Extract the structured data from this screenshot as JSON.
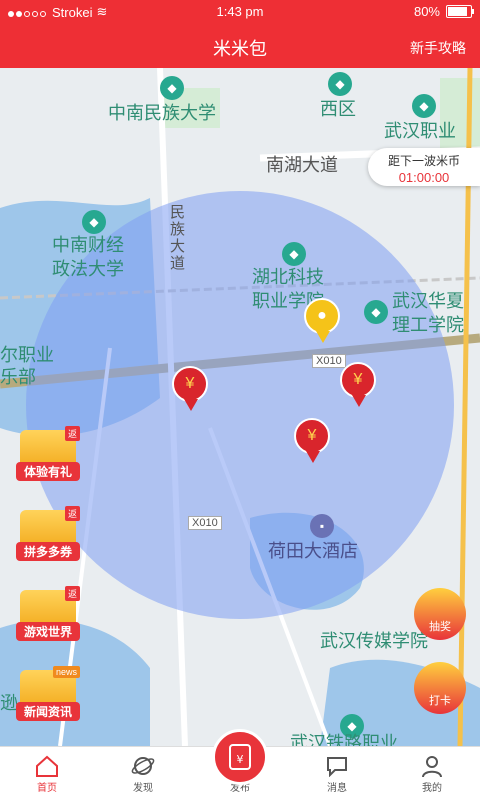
{
  "status": {
    "carrier": "Strokei",
    "time": "1:43 pm",
    "battery": "80%"
  },
  "nav": {
    "title": "米米包",
    "guide": "新手攻略"
  },
  "map": {
    "labels": {
      "zhongnan_minzu": "中南民族大学",
      "xiqu": "西区",
      "wuhan_zhiye": "武汉职业",
      "nanhu_road": "南湖大道",
      "zhongnan_caijing_1": "中南财经",
      "zhongnan_caijing_2": "政法大学",
      "minzu_road": "民族大道",
      "hubei_keji_1": "湖北科技",
      "hubei_keji_2": "职业学院",
      "wuhan_huaxia_1": "武汉华夏",
      "wuhan_huaxia_2": "理工学院",
      "left_cut_1": "尔职业",
      "left_cut_2": "乐部",
      "hetian": "荷田大酒店",
      "wuhan_chuanmei": "武汉传媒学院",
      "wuhan_tielu": "武汉铁路职业",
      "left_bottom": "逊"
    },
    "road_tag_1": "X010",
    "road_tag_2": "X010"
  },
  "countdown": {
    "label": "距下一波米币",
    "time": "01:00:00"
  },
  "side_menu": [
    {
      "label": "体验有礼",
      "tag": "返"
    },
    {
      "label": "拼多多券",
      "tag": "返"
    },
    {
      "label": "游戏世界",
      "tag": "返"
    },
    {
      "label": "新闻资讯",
      "tag": "news"
    }
  ],
  "right_buttons": {
    "lottery": "抽奖",
    "checkin": "打卡"
  },
  "tabs": [
    {
      "label": "首页"
    },
    {
      "label": "发现"
    },
    {
      "label": "发布"
    },
    {
      "label": "消息"
    },
    {
      "label": "我的"
    }
  ],
  "colors": {
    "brand": "#ee2f35",
    "circle": "#8fa6f0",
    "road": "#b7aa7e"
  }
}
